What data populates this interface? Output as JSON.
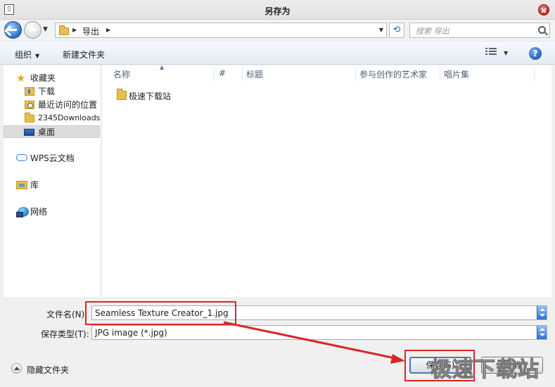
{
  "window": {
    "title": "另存为"
  },
  "address": {
    "breadcrumb": "导出"
  },
  "search": {
    "placeholder": "搜索 导出"
  },
  "toolbar": {
    "organize": "组织",
    "new_folder": "新建文件夹"
  },
  "nav_pane": {
    "favorites": "收藏夹",
    "downloads": "下载",
    "recent": "最近访问的位置",
    "downloads2345": "2345Downloads",
    "desktop": "桌面",
    "wps_cloud": "WPS云文档",
    "library": "库",
    "network": "网络"
  },
  "columns": [
    "名称",
    "#",
    "标题",
    "参与创作的艺术家",
    "唱片集"
  ],
  "files": [
    {
      "name": "极速下载站"
    }
  ],
  "form": {
    "filename_label": "文件名(N):",
    "filename_value": "Seamless Texture Creator_1.jpg",
    "filetype_label": "保存类型(T):",
    "filetype_value": "JPG image (*.jpg)"
  },
  "footer": {
    "hide_folders": "隐藏文件夹",
    "save": "保存(S)",
    "cancel": "取消"
  },
  "watermark": "极速下载站",
  "colors": {
    "highlight": "#d9262b",
    "accent": "#2f7fd8"
  }
}
